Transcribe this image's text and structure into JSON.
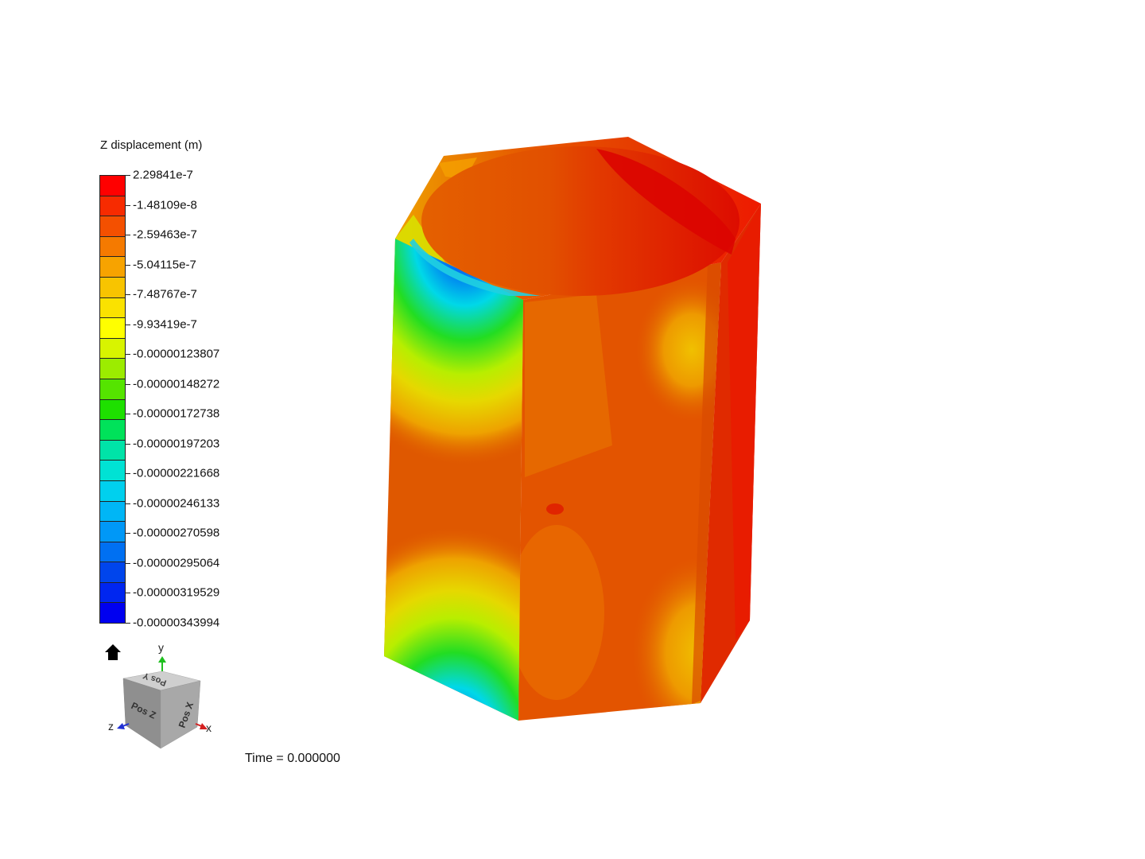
{
  "legend": {
    "title": "Z displacement (m)",
    "band_colors": [
      "#ff0000",
      "#f72b00",
      "#f45000",
      "#f57a00",
      "#f7a300",
      "#f8c400",
      "#fae200",
      "#ffff00",
      "#d8f400",
      "#9cec00",
      "#55e400",
      "#1ee000",
      "#00e25a",
      "#00e3a8",
      "#00e2d4",
      "#00d0ee",
      "#00b6f6",
      "#0098f7",
      "#0070f2",
      "#0045ec",
      "#0026f0",
      "#0000f0"
    ],
    "labels": [
      "2.29841e-7",
      "-1.48109e-8",
      "-2.59463e-7",
      "-5.04115e-7",
      "-7.48767e-7",
      "-9.93419e-7",
      "-0.00000123807",
      "-0.00000148272",
      "-0.00000172738",
      "-0.00000197203",
      "-0.00000221668",
      "-0.00000246133",
      "-0.00000270598",
      "-0.00000295064",
      "-0.00000319529",
      "-0.00000343994"
    ]
  },
  "orientation": {
    "axis_y": "y",
    "axis_x": "x",
    "axis_z": "z",
    "face_top": "Pos Y",
    "face_front": "Pos Z",
    "face_right": "Pos X",
    "home_icon": "home-icon"
  },
  "status": {
    "time": "Time = 0.000000"
  },
  "model": {
    "description_colors": {
      "red": "#ee2200",
      "orange_red": "#e65000",
      "orange": "#eb7a00",
      "yellow": "#e6d800",
      "green": "#22dd22",
      "cyan": "#00d8e8",
      "blue": "#0022ee"
    }
  }
}
